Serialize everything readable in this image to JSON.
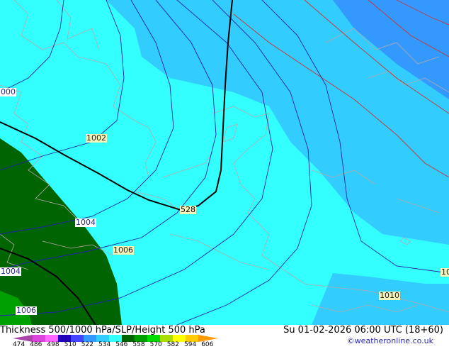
{
  "map": {
    "isobar_labels": [
      "1002",
      "1004",
      "1006",
      "1004",
      "1006",
      "1010",
      "000",
      "10"
    ],
    "thickness_label": "528",
    "colors": {
      "deep_green": "#006400",
      "green": "#00a000",
      "cyan": "#33ffff",
      "light_blue": "#33ccff",
      "mid_blue": "#3399ff",
      "isobar": "#2222aa",
      "thickness_contour": "#cc3333",
      "coastline": "#b4a8a8",
      "height500": "#000000"
    }
  },
  "footer": {
    "title": "Thickness 500/1000 hPa/SLP/Height 500 hPa",
    "datetime": "Su 01-02-2026 06:00 UTC (18+60)",
    "credit": "©weatheronline.co.uk",
    "colorbar_ticks": [
      "474",
      "486",
      "498",
      "510",
      "522",
      "534",
      "546",
      "558",
      "570",
      "582",
      "594",
      "606"
    ],
    "colorbar_colors": [
      "#aa44aa",
      "#dd44dd",
      "#ff66ff",
      "#2200bb",
      "#4444ff",
      "#3399ff",
      "#33ccff",
      "#33ffff",
      "#006400",
      "#00a000",
      "#00dd00",
      "#aadd00",
      "#ffff00",
      "#ffcc00",
      "#ff9900"
    ]
  }
}
